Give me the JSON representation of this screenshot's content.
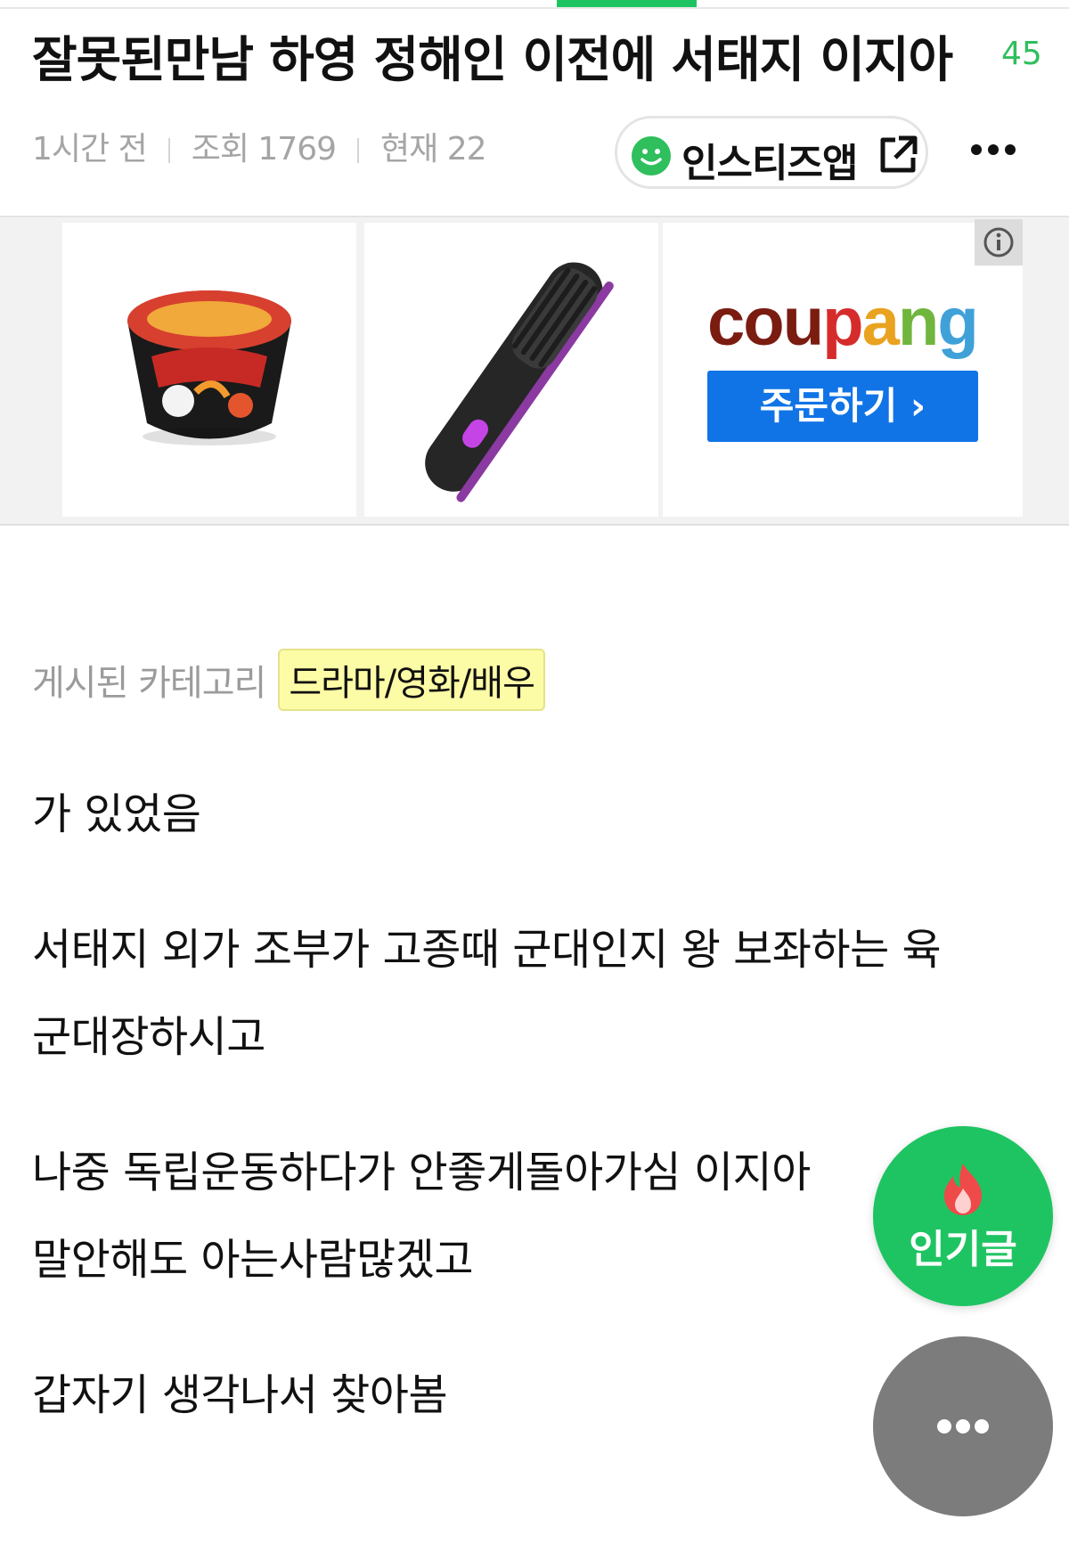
{
  "post": {
    "title": "잘못된만남 하영 정해인 이전에 서태지 이지아",
    "comment_count": "45",
    "time_ago": "1시간 전",
    "views": "조회 1769",
    "current": "현재 22"
  },
  "app_button": {
    "label": "인스티즈앱"
  },
  "ad": {
    "brand": [
      "c",
      "o",
      "u",
      "p",
      "a",
      "n",
      "g"
    ],
    "order_label": "주문하기 ›"
  },
  "category": {
    "label": "게시된 카테고리",
    "value": "드라마/영화/배우"
  },
  "content": {
    "lines": [
      "가 있었음",
      "서태지 외가 조부가 고종때 군대인지  왕 보좌하는 육",
      "군대장하시고",
      "나중 독립운동하다가 안좋게돌아가심 이지아",
      "말안해도 아는사람많겠고",
      "갑자기 생각나서 찾아봄"
    ]
  },
  "fab": {
    "popular_label": "인기글"
  },
  "colors": {
    "accent_green": "#1fc462",
    "coupang_blue": "#1174e6",
    "tag_yellow": "#fdfca6"
  },
  "icons": [
    "smile-icon",
    "external-link-icon",
    "more-dots-icon",
    "info-icon",
    "flame-icon"
  ]
}
